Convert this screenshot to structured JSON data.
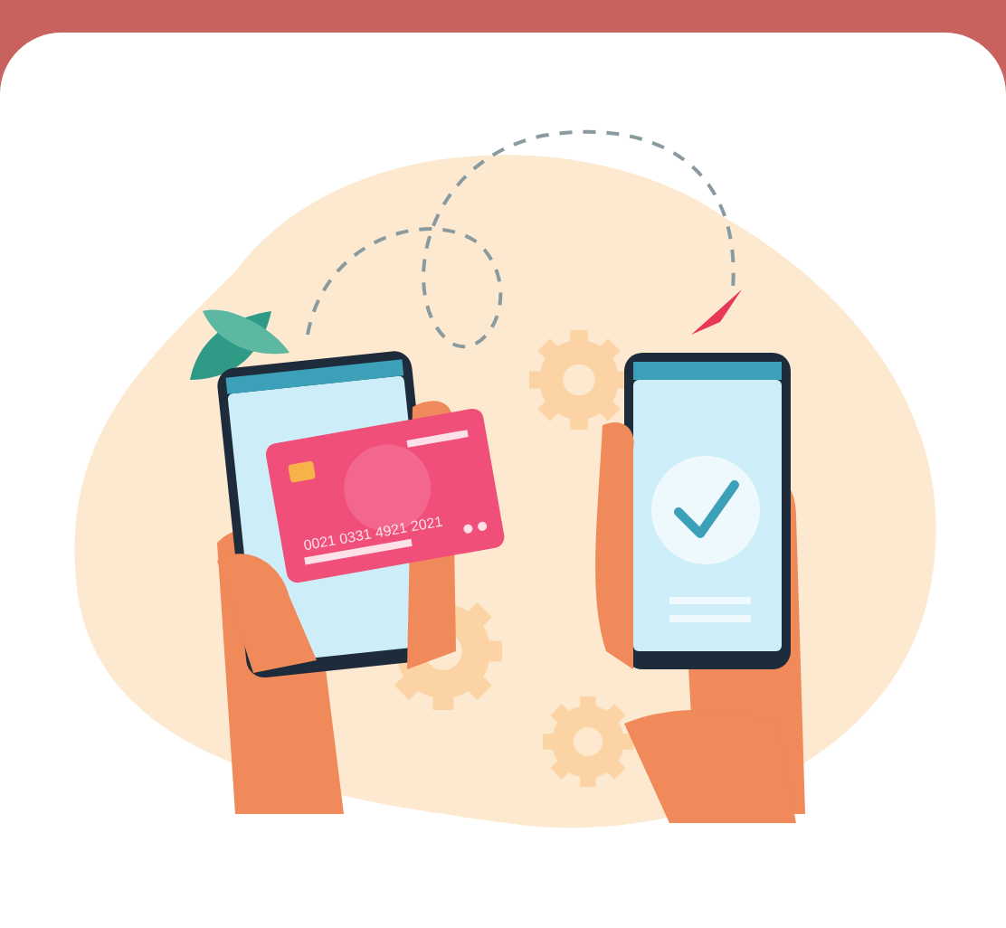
{
  "illustration": {
    "card_number": "0021 0331 4921 2021"
  }
}
